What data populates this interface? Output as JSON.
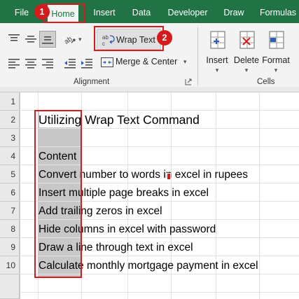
{
  "tabs": {
    "file": "File",
    "home": "Home",
    "insert": "Insert",
    "data": "Data",
    "developer": "Developer",
    "draw": "Draw",
    "formulas": "Formulas"
  },
  "ribbon": {
    "wrap_text_label": "Wrap Text",
    "merge_center_label": "Merge & Center",
    "insert_label": "Insert",
    "delete_label": "Delete",
    "format_label": "Format",
    "alignment_group": "Alignment",
    "cells_group": "Cells"
  },
  "annotations": {
    "badge_1": "1",
    "badge_2": "2"
  },
  "sheet": {
    "row_numbers": [
      "1",
      "2",
      "3",
      "4",
      "5",
      "6",
      "7",
      "8",
      "9",
      "10"
    ],
    "cells": {
      "r2": "Utilizing Wrap Text Command",
      "r4": "Content",
      "r5": "Convert number to words in excel in rupees",
      "r6": "Insert multiple page breaks in excel",
      "r7": "Add trailing zeros in excel",
      "r8": "Hide columns in excel with password",
      "r9": "Draw a line through text in excel",
      "r10": "Calculate monthly mortgage payment in excel"
    }
  },
  "colors": {
    "excel_green": "#217346",
    "annotation_red": "#d51b1b",
    "selection_gray": "#c7c7c7"
  }
}
